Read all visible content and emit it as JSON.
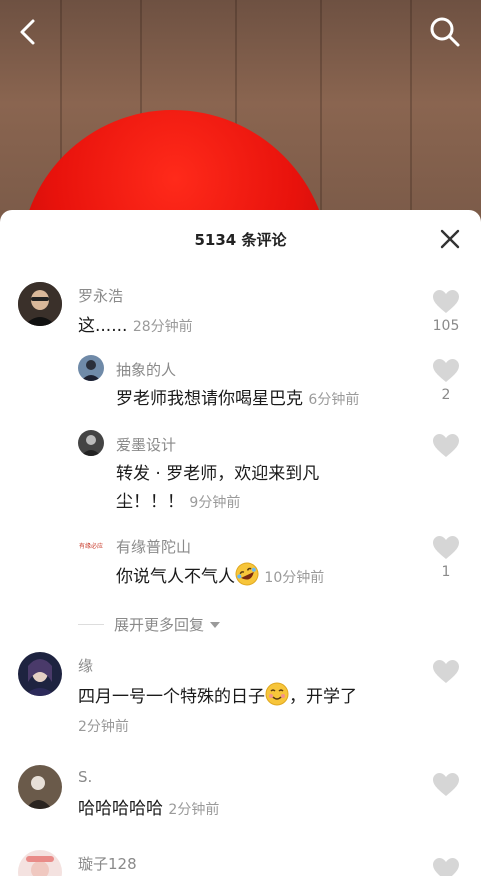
{
  "nav": {
    "back_icon": "back-arrow-icon",
    "search_icon": "search-icon"
  },
  "comments_panel": {
    "title": "5134 条评论",
    "close_icon": "close-icon",
    "expand_more": "展开更多回复",
    "comments": [
      {
        "user": "罗永浩",
        "text": "这......",
        "time": "28分钟前",
        "likes": "105"
      },
      {
        "user": "抽象的人",
        "text": "罗老师我想请你喝星巴克",
        "time": "6分钟前",
        "likes": "2"
      },
      {
        "user": "爱墨设计",
        "text_line1": "转发 · 罗老师，欢迎来到凡",
        "text_line2": "尘！！！",
        "time": "9分钟前",
        "likes": ""
      },
      {
        "user": "有缘普陀山",
        "text": "你说气人不气人",
        "time": "10分钟前",
        "likes": "1"
      },
      {
        "user": "缘",
        "text_before": "四月一号一个特殊的日子",
        "text_after": "，开学了",
        "time": "2分钟前",
        "likes": ""
      },
      {
        "user": "S.",
        "text": "哈哈哈哈哈",
        "time": "2分钟前",
        "likes": ""
      },
      {
        "user": "璇子128"
      }
    ],
    "avatar_labels": {
      "youyuan": "有缘必应"
    }
  },
  "colors": {
    "accent": "#e8120c",
    "meta_gray": "#8a8a8a"
  }
}
